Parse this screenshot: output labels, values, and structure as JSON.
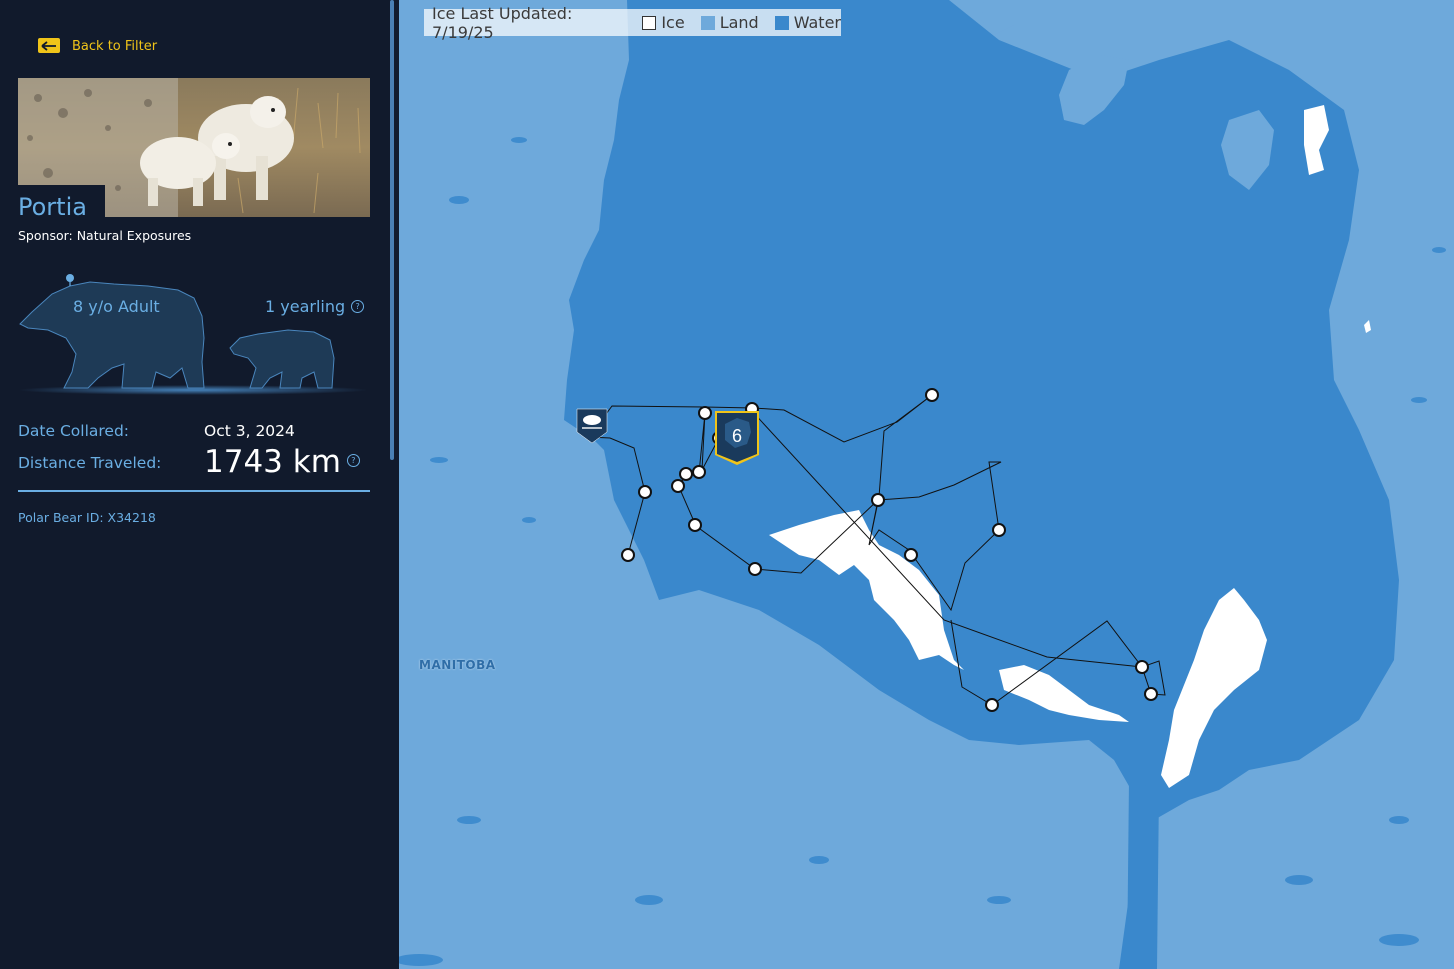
{
  "sidebar": {
    "back_label": "Back to Filter",
    "bear_name": "Portia",
    "sponsor": "Sponsor: Natural Exposures",
    "age_label": "8 y/o Adult",
    "cub_label": "1 yearling",
    "date_collared_label": "Date Collared:",
    "date_collared_value": "Oct 3, 2024",
    "distance_label": "Distance Traveled:",
    "distance_value": "1743 km",
    "bear_id": "Polar Bear ID: X34218",
    "help_glyph": "?",
    "back_icon": "arrow-left-icon",
    "accent_color": "#6aaee3",
    "back_color": "#f0c419"
  },
  "map": {
    "legend": {
      "title": "Ice Last Updated: 7/19/25",
      "items": [
        {
          "label": "Ice",
          "color": "#ffffff"
        },
        {
          "label": "Land",
          "color": "#6ea9db"
        },
        {
          "label": "Water",
          "color": "#3a88cc"
        }
      ]
    },
    "province_label": "MANITOBA",
    "cluster_count": "6",
    "start_marker_icon": "polar-bear-logo-icon",
    "colors": {
      "land": "#6ea9db",
      "water": "#3a88cc",
      "ice": "#ffffff",
      "track": "#111111",
      "cluster": "#1a3a5c"
    }
  }
}
